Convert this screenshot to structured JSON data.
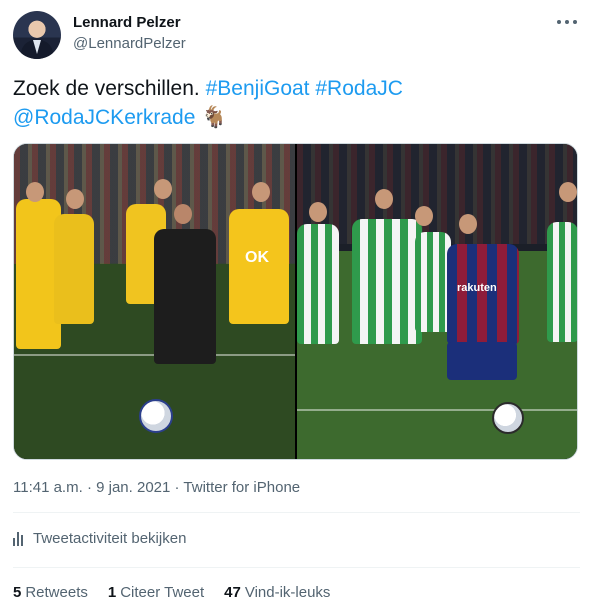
{
  "author": {
    "name": "Lennard Pelzer",
    "handle": "@LennardPelzer"
  },
  "tweet": {
    "text_plain": "Zoek de verschillen.",
    "hashtag_1": "#BenjiGoat",
    "hashtag_2": "#RodaJC",
    "mention": "@RodaJCKerkrade",
    "emoji": "🐐"
  },
  "meta": {
    "time": "11:41 a.m.",
    "separator": "·",
    "date": "9 jan. 2021",
    "source": "Twitter for iPhone"
  },
  "activity_label": "Tweetactiviteit bekijken",
  "stats": {
    "retweets_count": "5",
    "retweets_label": "Retweets",
    "quotes_count": "1",
    "quotes_label": "Citeer Tweet",
    "likes_count": "47",
    "likes_label": "Vind-ik-leuks"
  },
  "photos": {
    "left_shirt_text": "OK",
    "right_shirt_text": "rakuten"
  },
  "colors": {
    "link": "#1d9bf0",
    "secondary_text": "#536471",
    "primary_text": "#0f1419"
  },
  "icons": [
    "more-options-icon",
    "activity-bars-icon"
  ]
}
